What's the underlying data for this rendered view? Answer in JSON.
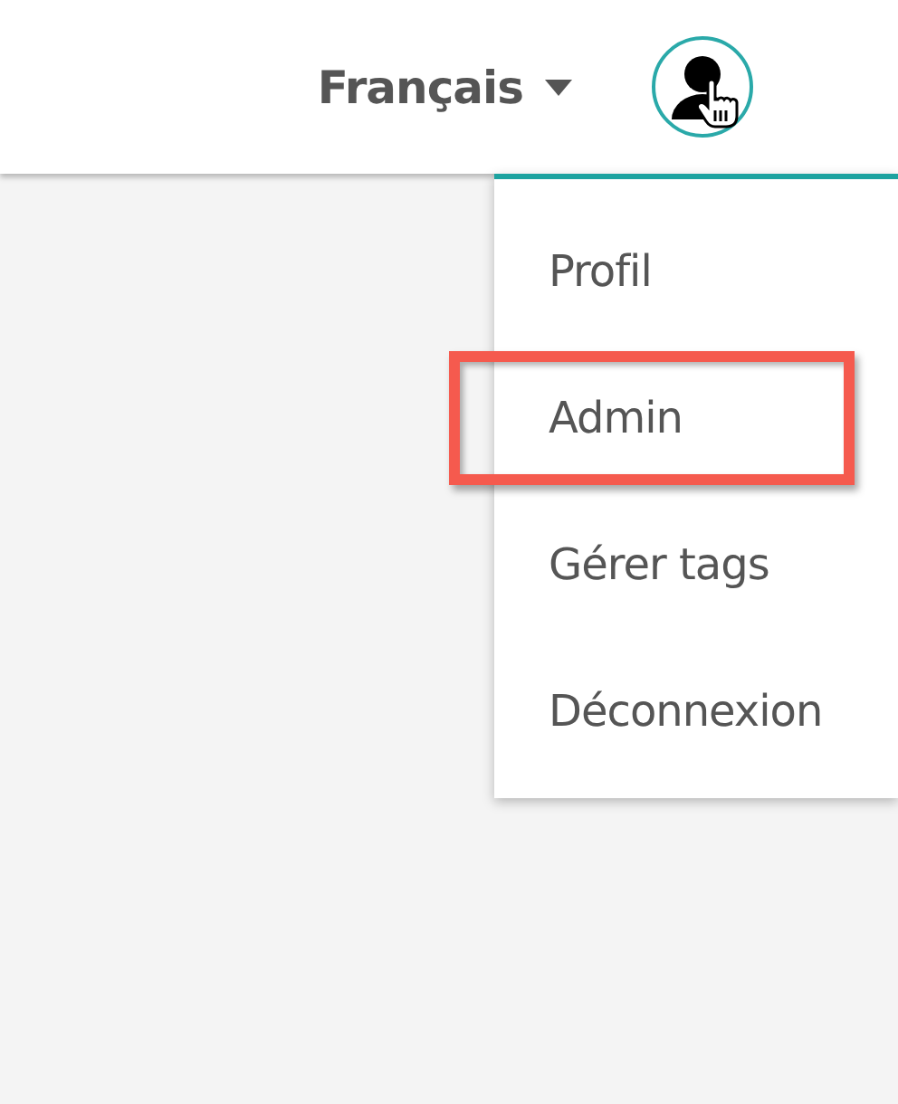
{
  "header": {
    "language": "Français"
  },
  "user_menu": {
    "open": true,
    "items": [
      {
        "label": "Profil",
        "highlighted": false
      },
      {
        "label": "Admin",
        "highlighted": true
      },
      {
        "label": "Gérer tags",
        "highlighted": false
      },
      {
        "label": "Déconnexion",
        "highlighted": false
      }
    ]
  }
}
